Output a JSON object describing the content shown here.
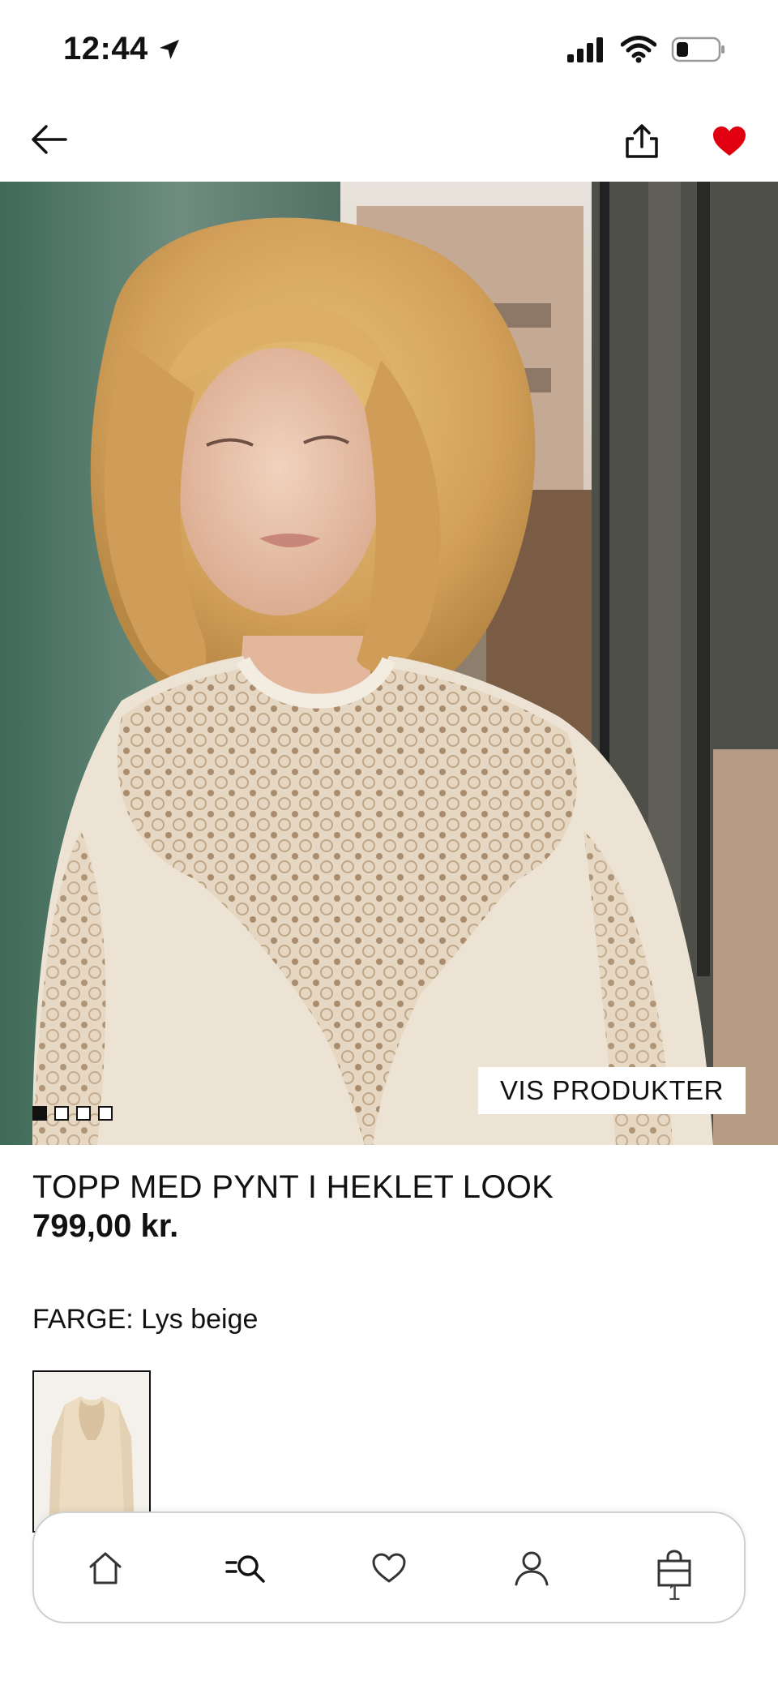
{
  "status_bar": {
    "time": "12:44"
  },
  "nav": {
    "back_icon": "arrow-left-icon",
    "share_icon": "share-icon",
    "favorite_icon": "heart-filled-icon",
    "favorite_color": "#e1000f"
  },
  "gallery": {
    "image_count": 4,
    "active_index": 0,
    "show_products_label": "VIS PRODUKTER"
  },
  "product": {
    "title": "TOPP MED PYNT I HEKLET LOOK",
    "price": "799,00 kr.",
    "color_label": "FARGE: Lys beige"
  },
  "bottom_nav": {
    "tabs": [
      {
        "icon": "home-icon"
      },
      {
        "icon": "search-menu-icon"
      },
      {
        "icon": "heart-outline-icon"
      },
      {
        "icon": "user-icon"
      },
      {
        "icon": "shopping-bag-icon"
      }
    ],
    "cart_count": "1"
  }
}
